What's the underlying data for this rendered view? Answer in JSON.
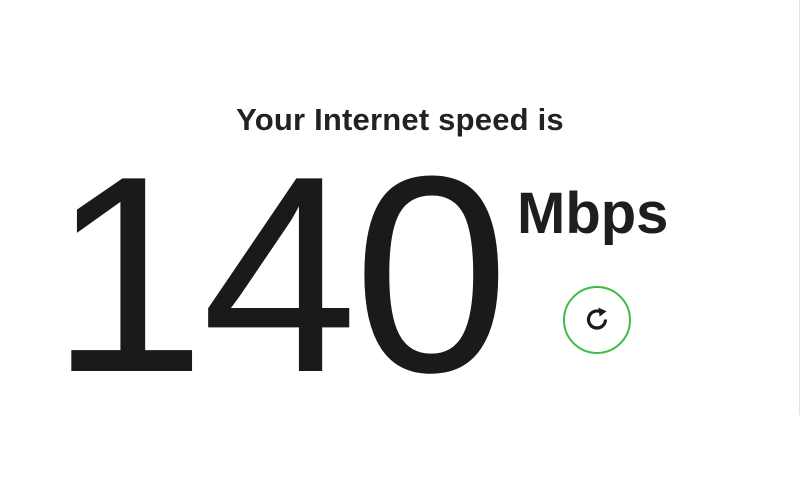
{
  "result": {
    "heading": "Your Internet speed is",
    "speed_value": "140",
    "speed_unit": "Mbps"
  },
  "controls": {
    "refresh_icon": "refresh-icon",
    "refresh_ring_color": "#3dbb45"
  },
  "colors": {
    "text": "#1a1a1a",
    "background": "#ffffff"
  }
}
